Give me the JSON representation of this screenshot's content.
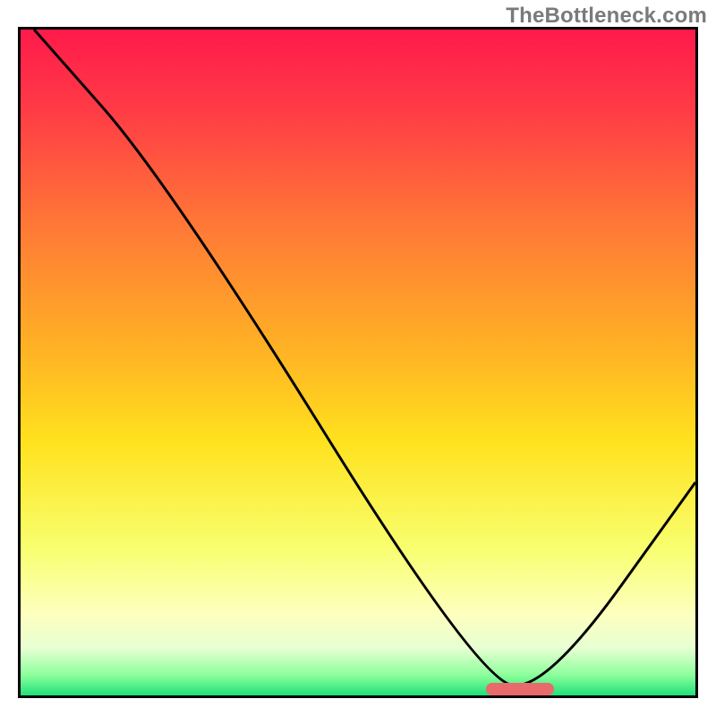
{
  "watermark": "TheBottleneck.com",
  "chart_data": {
    "type": "line",
    "title": "",
    "xlabel": "",
    "ylabel": "",
    "xlim": [
      0,
      100
    ],
    "ylim": [
      0,
      100
    ],
    "grid": false,
    "background": {
      "type": "vertical-gradient",
      "stops": [
        {
          "pos": 0,
          "color": "#ff1a4b"
        },
        {
          "pos": 12,
          "color": "#ff3b46"
        },
        {
          "pos": 30,
          "color": "#ff7a36"
        },
        {
          "pos": 48,
          "color": "#ffb224"
        },
        {
          "pos": 62,
          "color": "#ffe21e"
        },
        {
          "pos": 78,
          "color": "#f8ff70"
        },
        {
          "pos": 88,
          "color": "#fdffc0"
        },
        {
          "pos": 93,
          "color": "#e6ffd2"
        },
        {
          "pos": 97,
          "color": "#8aff9a"
        },
        {
          "pos": 100,
          "color": "#20e07a"
        }
      ]
    },
    "series": [
      {
        "name": "bottleneck-curve",
        "color": "#000000",
        "points": [
          {
            "x": 2,
            "y": 100
          },
          {
            "x": 22,
            "y": 77
          },
          {
            "x": 68,
            "y": 2
          },
          {
            "x": 78,
            "y": 1
          },
          {
            "x": 100,
            "y": 32
          }
        ]
      }
    ],
    "annotations": [
      {
        "name": "optimal-marker",
        "type": "pill",
        "color": "#e86a6a",
        "x_start": 69,
        "x_end": 79,
        "y": 1
      }
    ]
  }
}
